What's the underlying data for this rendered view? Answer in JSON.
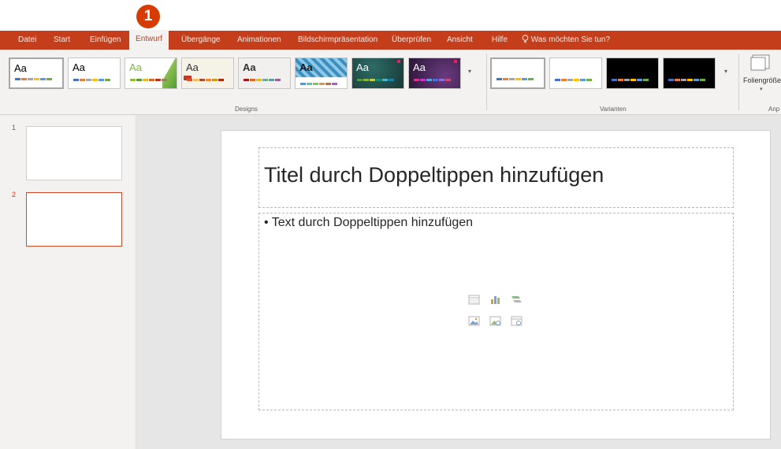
{
  "callout": "1",
  "tabs": [
    {
      "label": "Datei"
    },
    {
      "label": "Start"
    },
    {
      "label": "Einfügen"
    },
    {
      "label": "Entwurf",
      "active": true
    },
    {
      "label": "Übergänge"
    },
    {
      "label": "Animationen"
    },
    {
      "label": "Bildschirmpräsentation"
    },
    {
      "label": "Überprüfen"
    },
    {
      "label": "Ansicht"
    },
    {
      "label": "Hilfe"
    }
  ],
  "search": {
    "label": "Was möchten Sie tun?",
    "icon": "lightbulb-icon"
  },
  "ribbon": {
    "designs_label": "Designs",
    "variants_label": "Varianten",
    "customize_label": "Anp",
    "slide_size_label": "Foliengröße",
    "theme_sample": "Aa",
    "themes": [
      {
        "name": "Office",
        "bg": "#ffffff",
        "fg": "#000000"
      },
      {
        "name": "Office 2",
        "bg": "#ffffff",
        "fg": "#000000"
      },
      {
        "name": "Facette",
        "bg": "#ffffff",
        "fg": "#7ab543"
      },
      {
        "name": "Bogen",
        "bg": "#f5f2e8",
        "fg": "#333333"
      },
      {
        "name": "Ion",
        "bg": "#f2f0ee",
        "fg": "#333333"
      },
      {
        "name": "Muster",
        "bg": "#5ca9cf",
        "fg": "#1a1a1a"
      },
      {
        "name": "Dunkel-Türkis",
        "bg": "#1f4e4a",
        "fg": "#ffffff"
      },
      {
        "name": "Violett",
        "bg": "#4b2a5a",
        "fg": "#ffffff"
      }
    ],
    "variants": [
      {
        "bg": "#ffffff"
      },
      {
        "bg": "#ffffff"
      },
      {
        "bg": "#000000"
      },
      {
        "bg": "#000000"
      }
    ],
    "palette": [
      "#4472c4",
      "#ed7d31",
      "#a5a5a5",
      "#ffc000",
      "#5b9bd5",
      "#70ad47"
    ]
  },
  "slides": [
    {
      "number": "1"
    },
    {
      "number": "2",
      "selected": true
    }
  ],
  "slide": {
    "title_placeholder": "Titel durch Doppeltippen hinzufügen",
    "body_placeholder": "• Text durch Doppeltippen hinzufügen"
  }
}
